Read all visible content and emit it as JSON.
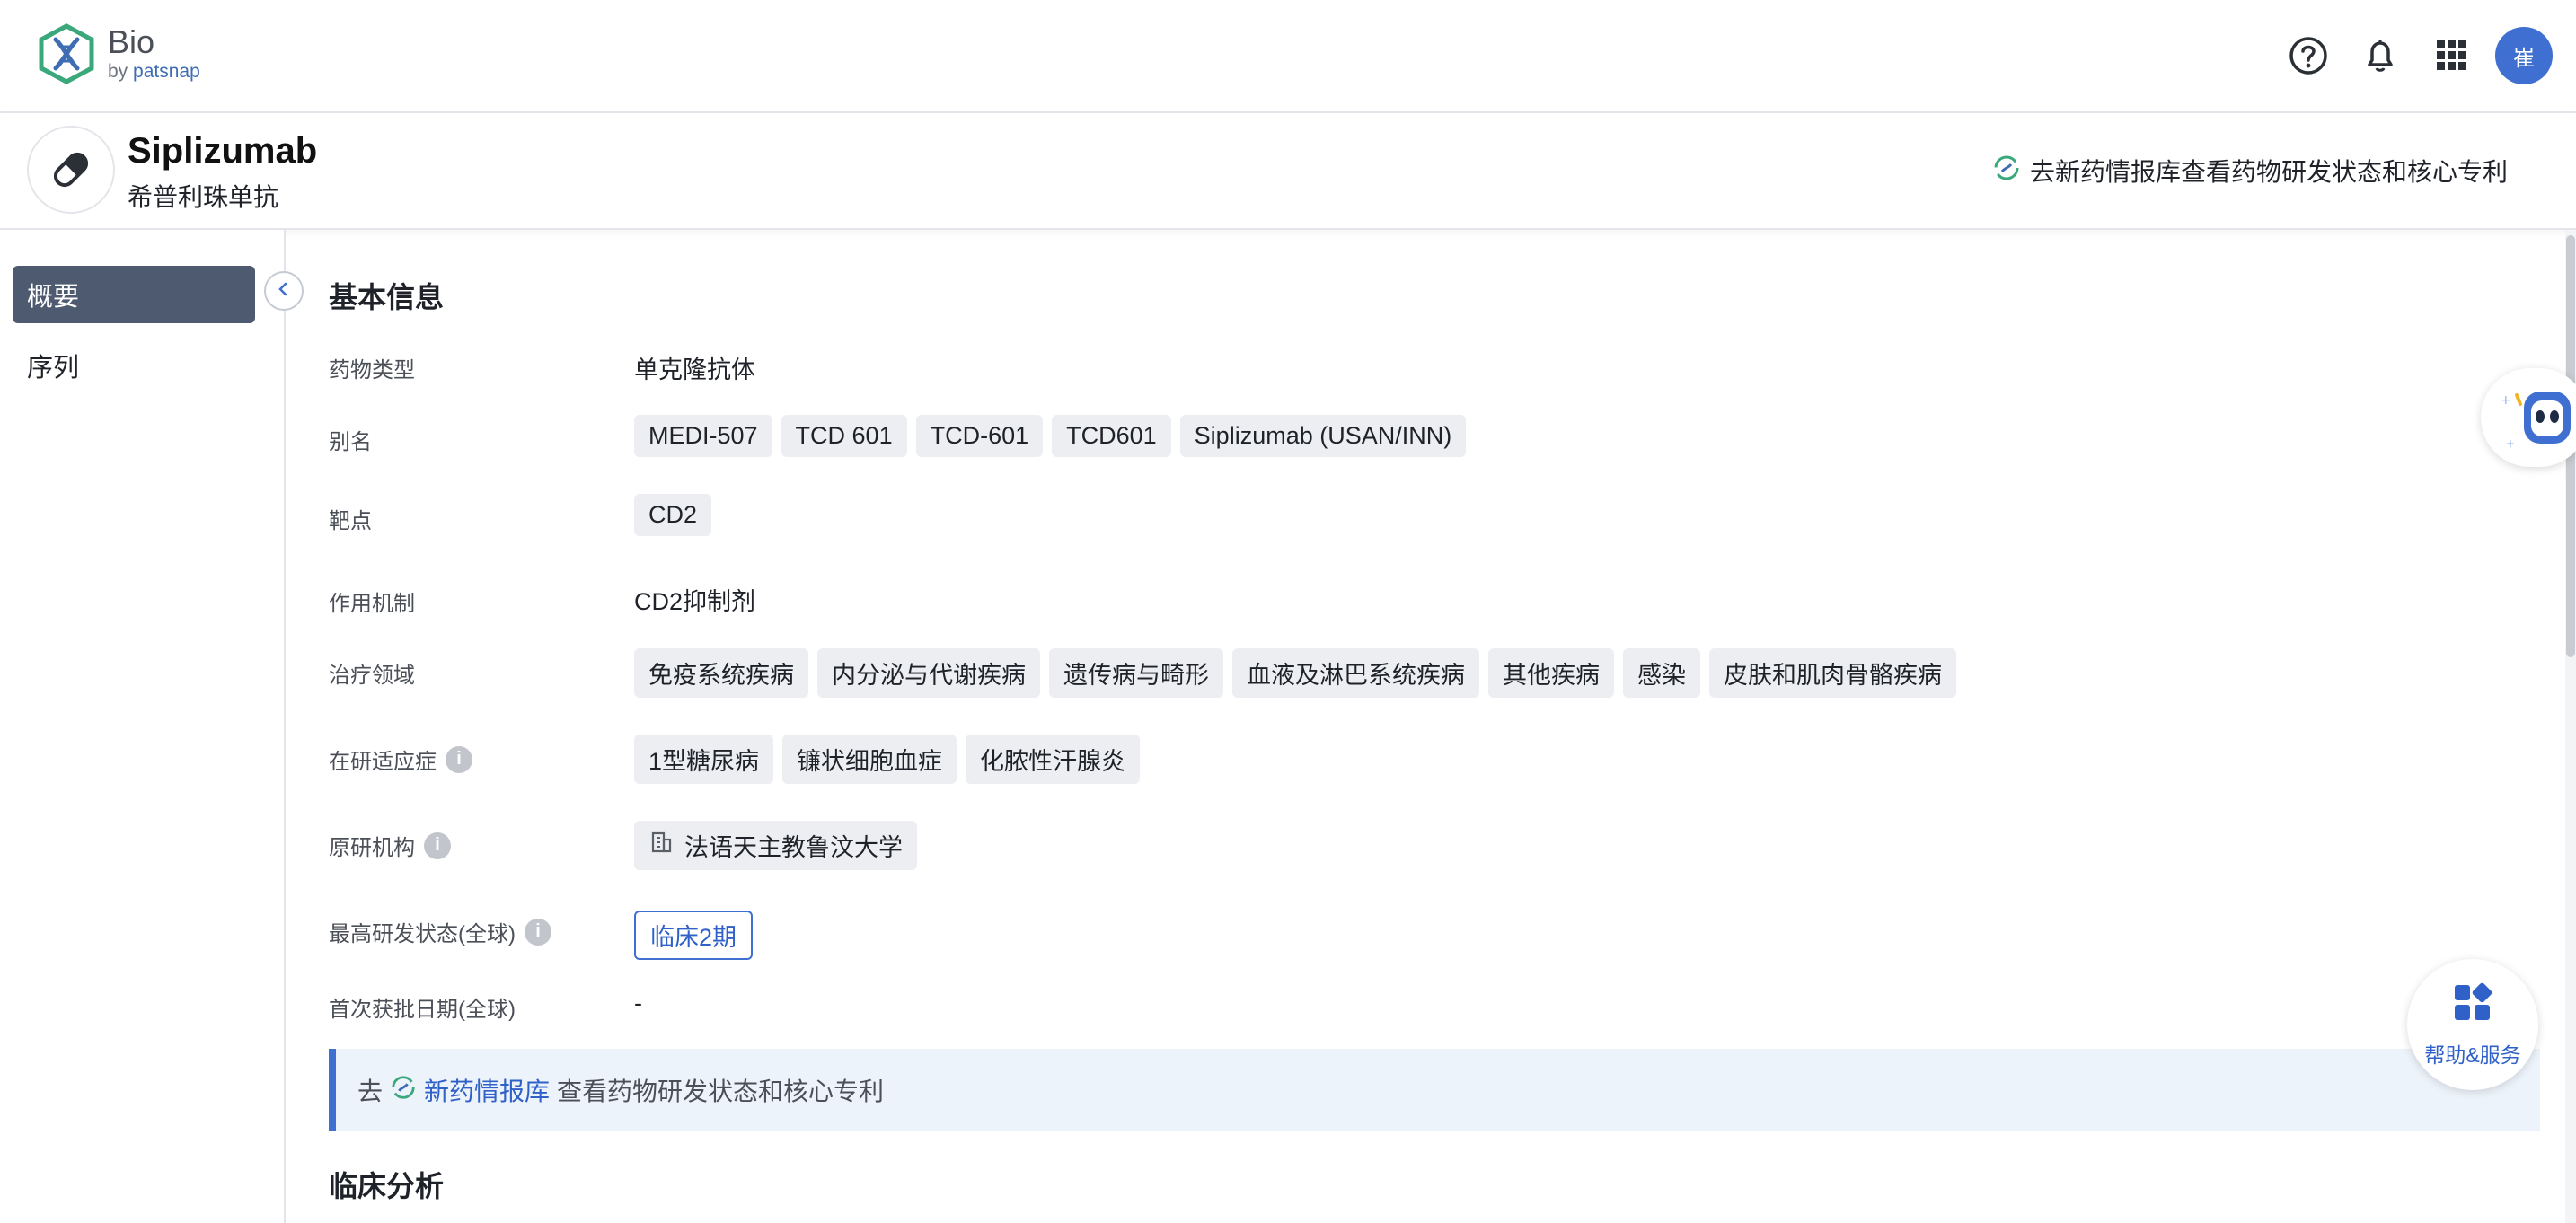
{
  "app": {
    "brand": "Bio",
    "by_label": "by",
    "by_brand": "patsnap",
    "avatar_text": "崔",
    "icons": [
      "help-icon",
      "bell-icon",
      "apps-grid-icon"
    ],
    "accent_color": "#3f6fd0"
  },
  "drug": {
    "name": "Siplizumab",
    "name_cn": "希普利珠单抗",
    "link_text": "去新药情报库查看药物研发状态和核心专利",
    "icon": "pill-icon"
  },
  "nav": {
    "items": [
      {
        "label": "概要",
        "active": true
      },
      {
        "label": "序列",
        "active": false
      }
    ]
  },
  "basic_info": {
    "title": "基本信息",
    "drug_type": {
      "label": "药物类型",
      "value": "单克隆抗体"
    },
    "aliases": {
      "label": "别名",
      "tags": [
        "MEDI-507",
        "TCD 601",
        "TCD-601",
        "TCD601",
        "Siplizumab (USAN/INN)"
      ]
    },
    "targets": {
      "label": "靶点",
      "tags": [
        "CD2"
      ]
    },
    "mechanism": {
      "label": "作用机制",
      "value": "CD2抑制剂"
    },
    "therapeutic_areas": {
      "label": "治疗领域",
      "tags": [
        "免疫系统疾病",
        "内分泌与代谢疾病",
        "遗传病与畸形",
        "血液及淋巴系统疾病",
        "其他疾病",
        "感染",
        "皮肤和肌肉骨骼疾病"
      ]
    },
    "indications": {
      "label": "在研适应症",
      "tags": [
        "1型糖尿病",
        "镰状细胞血症",
        "化脓性汗腺炎"
      ]
    },
    "originator": {
      "label": "原研机构",
      "value": "法语天主教鲁汶大学"
    },
    "highest_phase": {
      "label": "最高研发状态(全球)",
      "value": "临床2期"
    },
    "first_approval": {
      "label": "首次获批日期(全球)",
      "value": "-"
    }
  },
  "banner": {
    "prefix": "去",
    "link": "新药情报库",
    "suffix": "查看药物研发状态和核心专利"
  },
  "clinical": {
    "title": "临床分析"
  },
  "help": {
    "label": "帮助&服务"
  }
}
